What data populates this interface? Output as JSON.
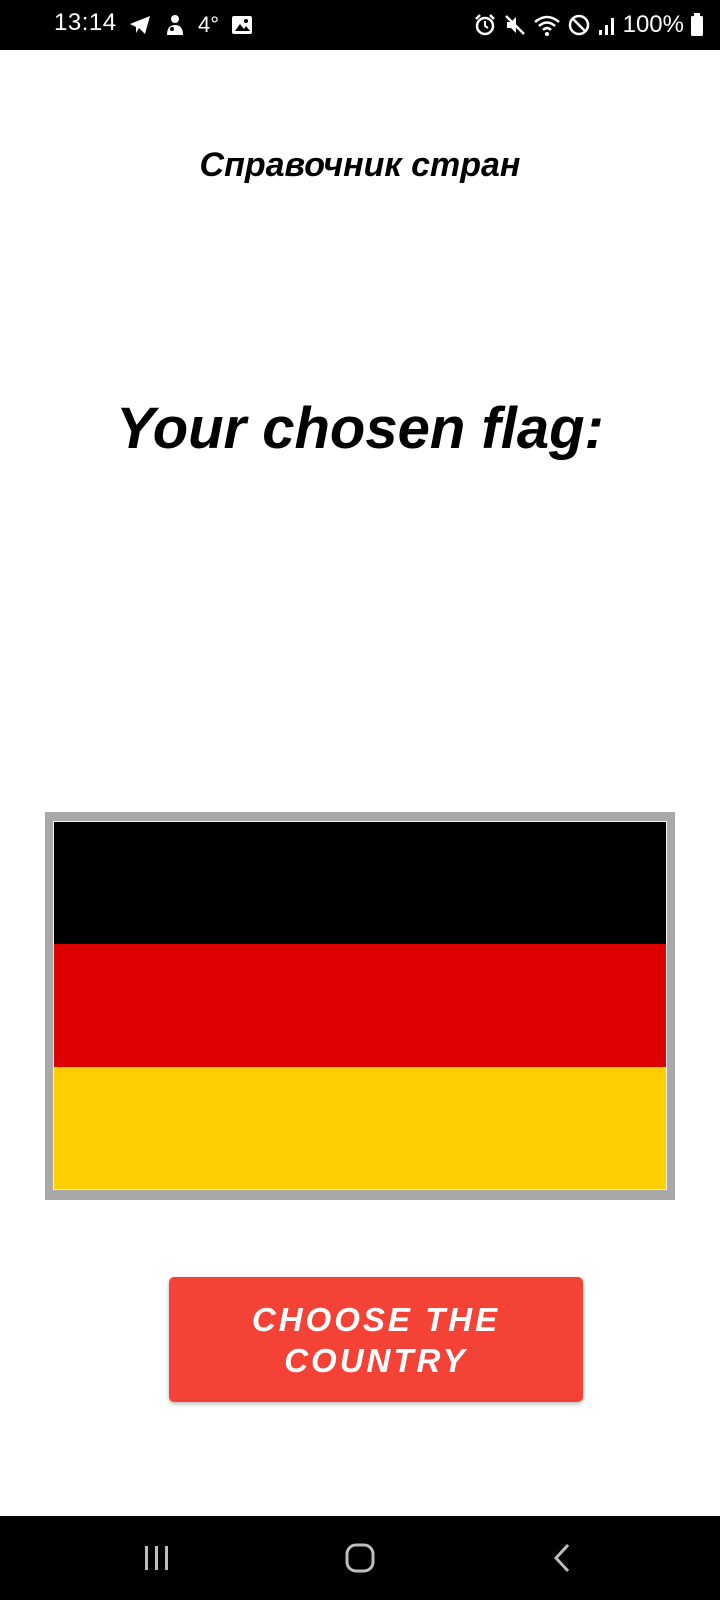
{
  "status_bar": {
    "time": "13:14",
    "temperature": "4°",
    "battery_percent": "100%",
    "icons_left": [
      "telegram-icon",
      "app-notification-icon",
      "gallery-icon"
    ],
    "icons_right": [
      "alarm-icon",
      "mute-icon",
      "wifi-icon",
      "do-not-disturb-icon",
      "signal-icon",
      "battery-icon"
    ]
  },
  "app": {
    "title": "Справочник стран",
    "headline": "Your chosen flag:",
    "flag": {
      "country": "Germany",
      "stripes": [
        "#000000",
        "#dd0000",
        "#ffce00"
      ]
    },
    "choose_button_label": "CHOOSE THE COUNTRY",
    "accent_color": "#f44336"
  },
  "nav_bar": {
    "buttons": [
      "recent-apps",
      "home",
      "back"
    ]
  }
}
